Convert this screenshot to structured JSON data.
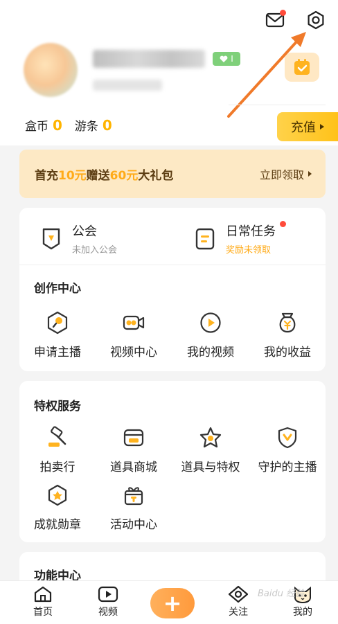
{
  "profile": {
    "level_badge": "I"
  },
  "balances": {
    "box_coin_label": "盒币",
    "box_coin_value": "0",
    "travel_label": "游条",
    "travel_value": "0"
  },
  "recharge": {
    "label": "充值"
  },
  "promo": {
    "prefix": "首充",
    "amount1": "10元",
    "middle": "赠送",
    "amount2": "60元",
    "suffix": "大礼包",
    "cta": "立即领取"
  },
  "guild": {
    "title": "公会",
    "subtitle": "未加入公会"
  },
  "daily_task": {
    "title": "日常任务",
    "subtitle": "奖励未领取"
  },
  "creation_center": {
    "title": "创作中心",
    "items": [
      {
        "label": "申请主播",
        "icon": "mic-icon"
      },
      {
        "label": "视频中心",
        "icon": "video-camera-icon"
      },
      {
        "label": "我的视频",
        "icon": "play-icon"
      },
      {
        "label": "我的收益",
        "icon": "yen-bag-icon"
      }
    ]
  },
  "privilege_service": {
    "title": "特权服务",
    "items": [
      {
        "label": "拍卖行",
        "icon": "gavel-icon"
      },
      {
        "label": "道具商城",
        "icon": "shop-icon"
      },
      {
        "label": "道具与特权",
        "icon": "star-icon"
      },
      {
        "label": "守护的主播",
        "icon": "shield-icon"
      },
      {
        "label": "成就勋章",
        "icon": "medal-icon"
      },
      {
        "label": "活动中心",
        "icon": "gift-icon"
      }
    ]
  },
  "function_center": {
    "title": "功能中心"
  },
  "bottom_nav": {
    "items": [
      {
        "label": "首页",
        "icon": "home-icon"
      },
      {
        "label": "视频",
        "icon": "video-icon"
      },
      {
        "label": "+",
        "icon": "plus-icon"
      },
      {
        "label": "关注",
        "icon": "eye-icon"
      },
      {
        "label": "我的",
        "icon": "cat-avatar-icon"
      }
    ]
  },
  "watermark": "Baidu 经验",
  "colors": {
    "accent": "#ffab19",
    "promo_bg": "#fde9c5",
    "red_dot": "#ff4b3a",
    "arrow": "#f07a2a"
  }
}
